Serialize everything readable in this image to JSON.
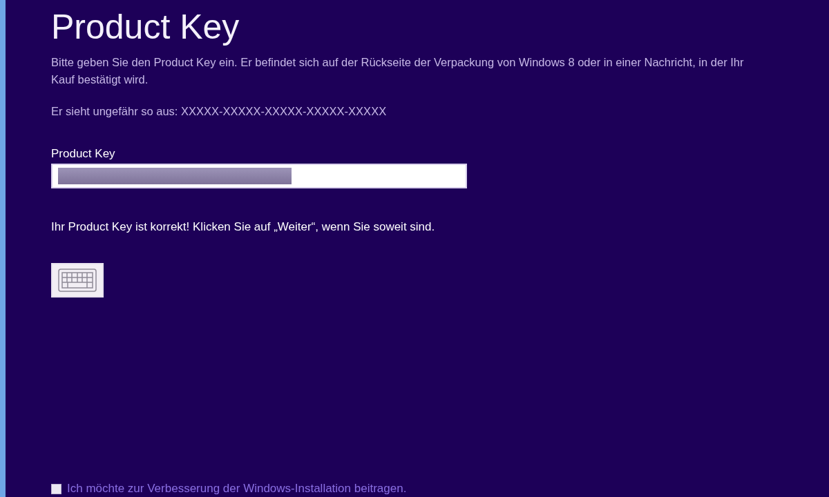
{
  "title": "Product Key",
  "intro": "Bitte geben Sie den Product Key ein. Er befindet sich auf der Rückseite der Verpackung von Windows 8 oder in einer Nachricht, in der Ihr Kauf bestätigt wird.",
  "example": "Er sieht ungefähr so aus: XXXXX-XXXXX-XXXXX-XXXXX-XXXXX",
  "field": {
    "label": "Product Key",
    "redacted": true
  },
  "status": "Ihr Product Key ist korrekt! Klicken Sie auf „Weiter“, wenn Sie soweit sind.",
  "consent": {
    "label": "Ich möchte zur Verbesserung der Windows-Installation beitragen.",
    "checked": false
  }
}
